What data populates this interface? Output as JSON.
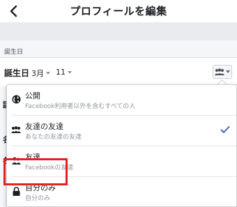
{
  "header": {
    "title": "プロフィールを編集",
    "back_icon": "chevron-left-icon"
  },
  "section": {
    "label": "誕生日"
  },
  "birthday": {
    "label": "誕生日",
    "month": "3月",
    "day": "11",
    "audience_icon": "friends-of-friends-icon"
  },
  "hidden_rows": {
    "row1": "誕",
    "row2": "名",
    "row3": "名"
  },
  "dropdown": {
    "options": [
      {
        "icon": "globe-icon",
        "title": "公開",
        "subtitle": "Facebook利用者以外を含むすべての人",
        "selected": false
      },
      {
        "icon": "friends-of-friends-icon",
        "title": "友達の友達",
        "subtitle": "あなたの友達の友達",
        "selected": true
      },
      {
        "icon": "friends-icon",
        "title": "友達",
        "subtitle": "Facebookの友達",
        "selected": false
      },
      {
        "icon": "lock-icon",
        "title": "自分のみ",
        "subtitle": "自分のみ",
        "selected": false
      }
    ]
  },
  "colors": {
    "accent": "#4267b2",
    "highlight": "#e0231e",
    "band": "#e9ebee"
  }
}
